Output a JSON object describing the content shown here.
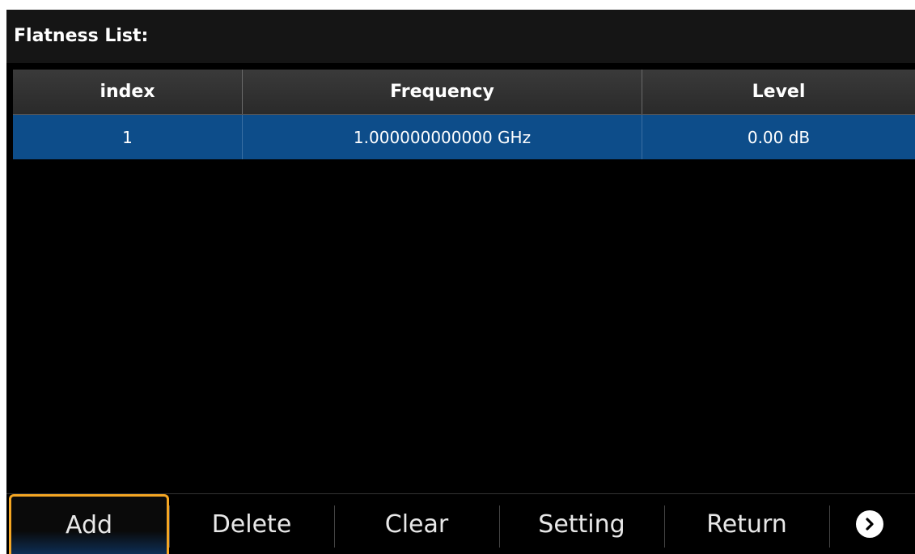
{
  "title": "Flatness List:",
  "table": {
    "headers": [
      "index",
      "Frequency",
      "Level"
    ],
    "rows": [
      {
        "index": "1",
        "frequency": "1.000000000000 GHz",
        "level": "0.00 dB",
        "selected": true
      }
    ]
  },
  "softkeys": {
    "add": "Add",
    "delete": "Delete",
    "clear": "Clear",
    "setting": "Setting",
    "return": "Return",
    "more_icon": "chevron-right-circle-icon"
  },
  "colors": {
    "selection": "#0d4d8a",
    "active_key_border": "#f5a623"
  }
}
